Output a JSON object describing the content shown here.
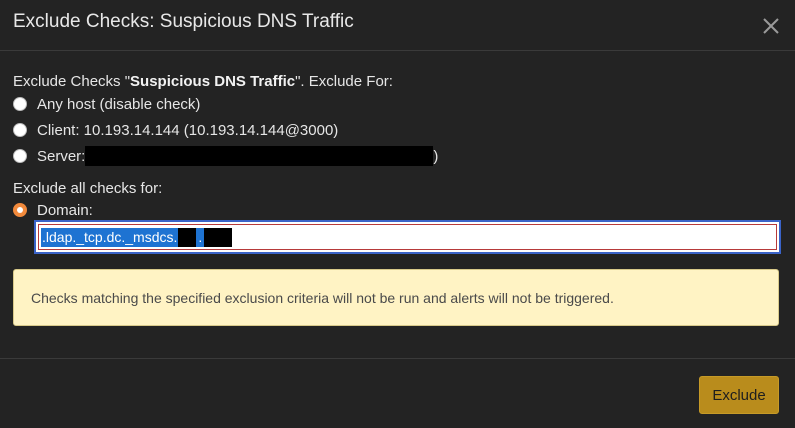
{
  "dialog": {
    "title": "Exclude Checks: Suspicious DNS Traffic",
    "close_icon": "close-icon"
  },
  "body": {
    "intro_prefix": "Exclude Checks \"",
    "check_name": "Suspicious DNS Traffic",
    "intro_suffix": "\". Exclude For:",
    "options": [
      {
        "label": "Any host (disable check)",
        "selected": false
      },
      {
        "label": "Client: 10.193.14.144 (10.193.14.144@3000)",
        "selected": false
      },
      {
        "label_prefix": "Server: ",
        "label_suffix": ")",
        "selected": false
      }
    ],
    "section_label": "Exclude all checks for:",
    "domain_option": {
      "label": "Domain:",
      "selected": true
    },
    "domain_input": {
      "value": ".ldap._tcp.dc._msdcs."
    },
    "alert": {
      "text": "Checks matching the specified exclusion criteria will not be run and alerts will not be triggered.",
      "background": "#fff3c4"
    }
  },
  "footer": {
    "exclude_label": "Exclude",
    "exclude_color": "#b98c1c"
  },
  "colors": {
    "background": "#232323",
    "radio_selected": "#f28a3c",
    "selection": "#1e73d2"
  }
}
